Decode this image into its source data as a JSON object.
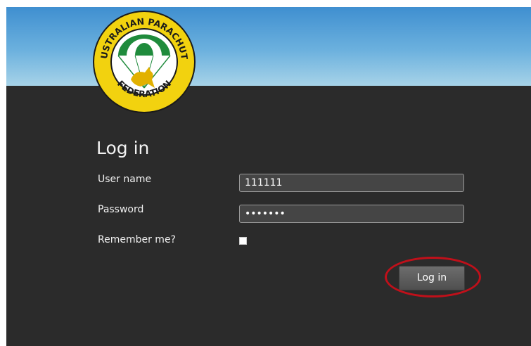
{
  "logo": {
    "top_text": "AUSTRALIAN PARACHUTE",
    "bottom_text": "FEDERATION",
    "icon": "parachute-kangaroo-icon"
  },
  "form": {
    "title": "Log in",
    "username_label": "User name",
    "username_value": "111111",
    "password_label": "Password",
    "password_value": "•••••••",
    "remember_label": "Remember me?",
    "remember_checked": false,
    "submit_label": "Log in"
  },
  "colors": {
    "panel_bg": "#2b2b2b",
    "sky": "#5aa4d8",
    "logo_yellow": "#f2d20f",
    "logo_green": "#1f8b3c",
    "highlight_red": "#c0101a"
  }
}
